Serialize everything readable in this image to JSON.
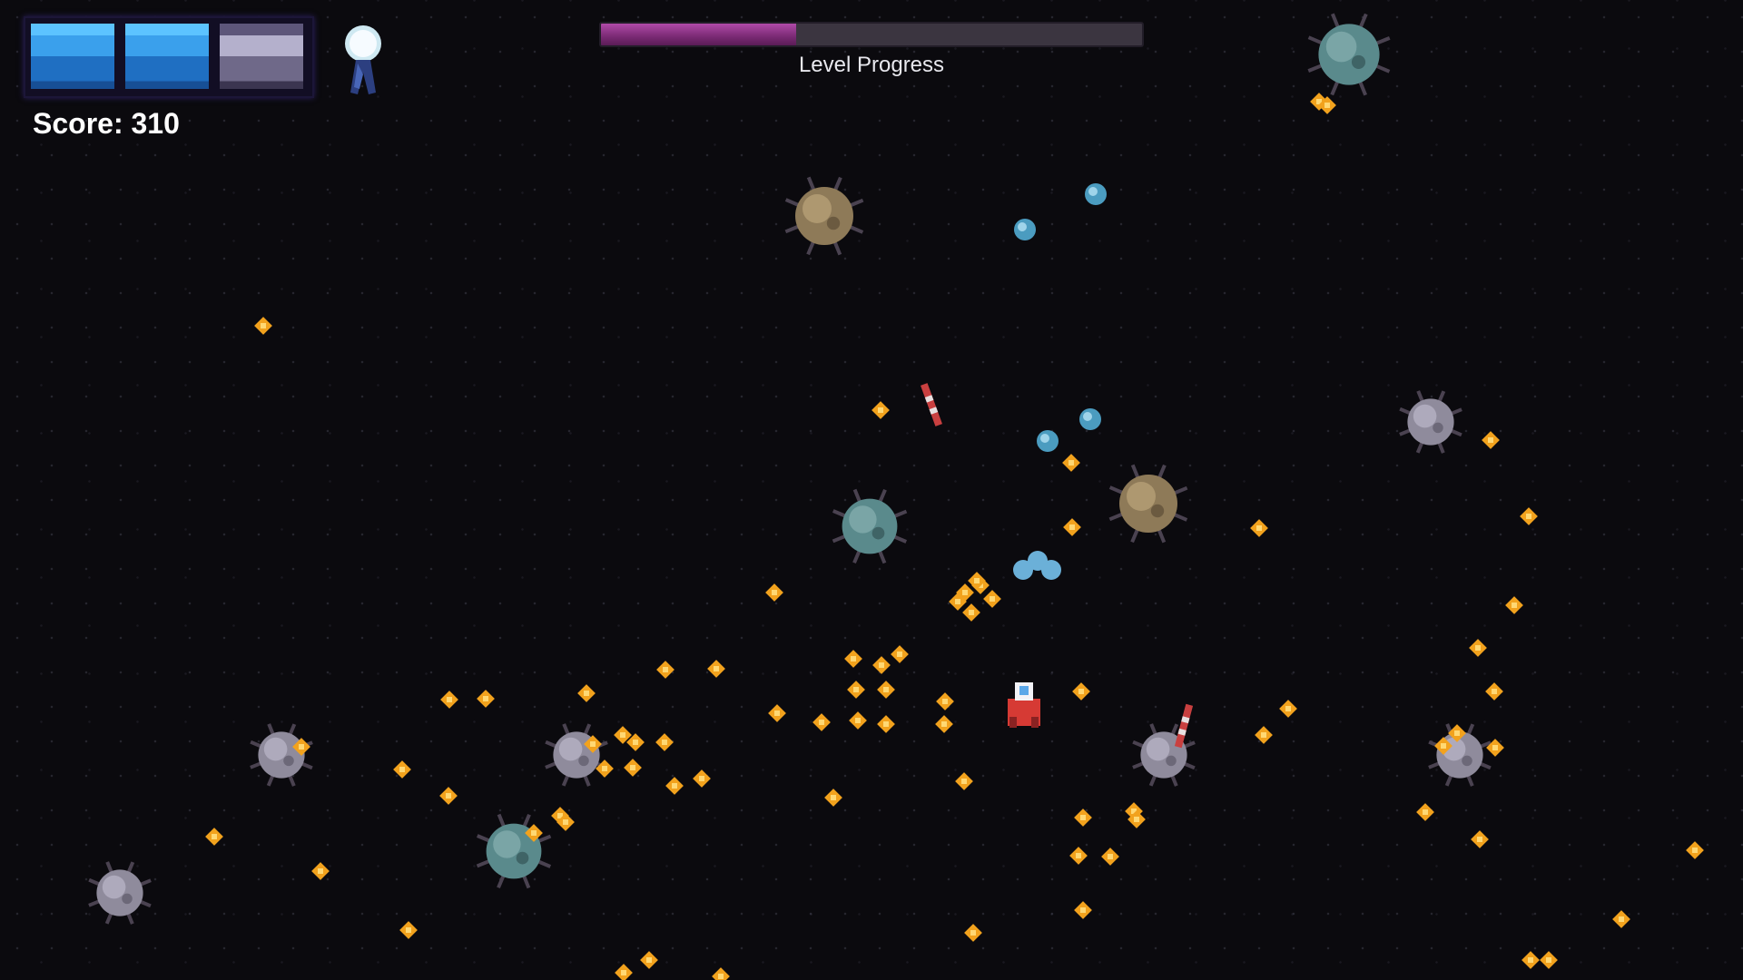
{
  "hud": {
    "health": {
      "segments_total": 3,
      "segments_filled": 2
    },
    "lives_icon": "ghost-pilot-icon",
    "score_label": "Score: 310"
  },
  "level": {
    "label": "Level Progress",
    "progress": 0.36
  },
  "colors": {
    "background": "#0b0a0e",
    "health_full": "#3aa0ec",
    "health_empty": "#6f6989",
    "progress_fill": "#8a3384",
    "coin": "#f2a21d"
  },
  "entities": {
    "player_ship": "player-ship",
    "enemies": [
      "asteroid-teal",
      "asteroid-brown",
      "asteroid-brown",
      "asteroid-teal",
      "asteroid-gray",
      "asteroid-gray",
      "asteroid-gray",
      "asteroid-gray",
      "asteroid-teal",
      "asteroid-gray",
      "asteroid-gray"
    ],
    "projectiles": [
      "red-missile",
      "red-missile"
    ],
    "pickups": [
      "blue-gem",
      "blue-gem",
      "blue-gem",
      "blue-gem"
    ],
    "coins": "gold-coin"
  }
}
